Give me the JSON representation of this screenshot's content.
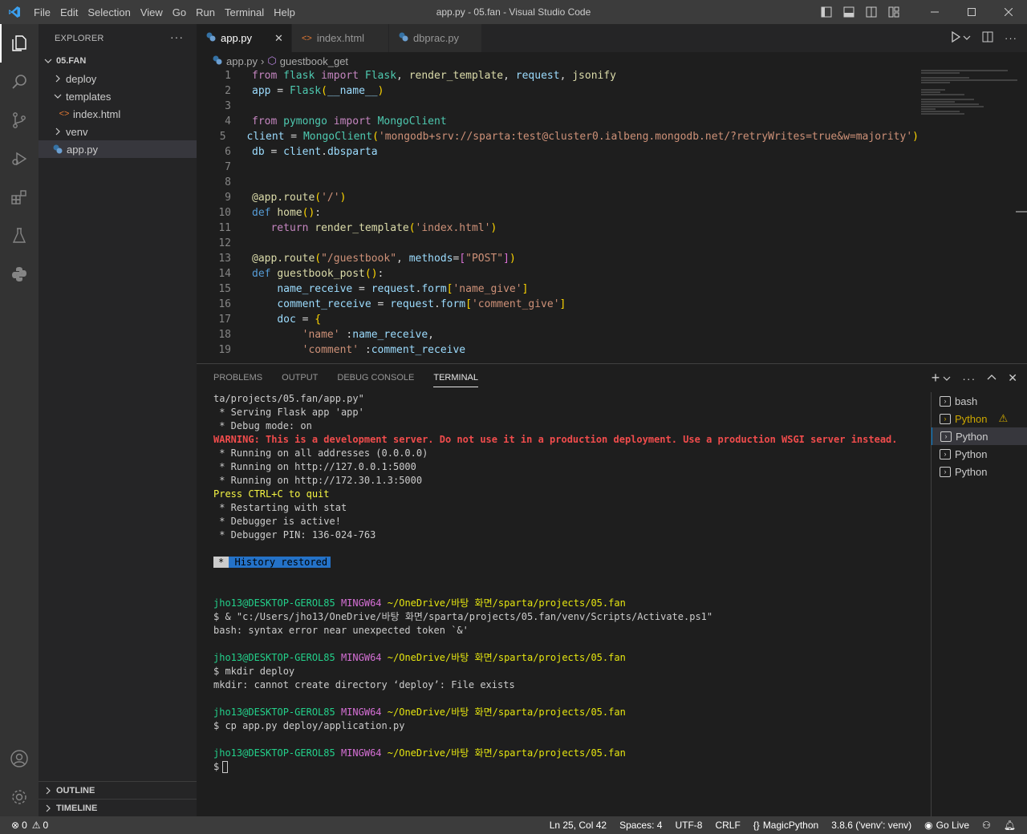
{
  "window": {
    "title": "app.py - 05.fan - Visual Studio Code",
    "menu": [
      "File",
      "Edit",
      "Selection",
      "View",
      "Go",
      "Run",
      "Terminal",
      "Help"
    ]
  },
  "sidebar": {
    "header": "EXPLORER",
    "root": "05.FAN",
    "items": [
      {
        "label": "deploy",
        "type": "folder",
        "expanded": false
      },
      {
        "label": "templates",
        "type": "folder",
        "expanded": true
      },
      {
        "label": "index.html",
        "type": "html-file"
      },
      {
        "label": "venv",
        "type": "folder",
        "expanded": false
      },
      {
        "label": "app.py",
        "type": "python-file",
        "selected": true
      }
    ],
    "outline": "OUTLINE",
    "timeline": "TIMELINE"
  },
  "tabs": [
    {
      "label": "app.py",
      "active": true
    },
    {
      "label": "index.html",
      "active": false
    },
    {
      "label": "dbprac.py",
      "active": false
    }
  ],
  "breadcrumb": {
    "file": "app.py",
    "symbol": "guestbook_get"
  },
  "code_lines": [
    "1",
    "2",
    "3",
    "4",
    "5",
    "6",
    "7",
    "8",
    "9",
    "10",
    "11",
    "12",
    "13",
    "14",
    "15",
    "16",
    "17",
    "18",
    "19"
  ],
  "panel": {
    "tabs": [
      "PROBLEMS",
      "OUTPUT",
      "DEBUG CONSOLE",
      "TERMINAL"
    ],
    "active_tab": "TERMINAL",
    "terminals": [
      {
        "label": "bash"
      },
      {
        "label": "Python",
        "warning": true
      },
      {
        "label": "Python",
        "selected": true
      },
      {
        "label": "Python"
      },
      {
        "label": "Python"
      }
    ],
    "output": {
      "l1": "ta/projects/05.fan/app.py\"",
      "l2": " * Serving Flask app 'app'",
      "l3": " * Debug mode: on",
      "l4": "WARNING: This is a development server. Do not use it in a production deployment. Use a production WSGI server instead.",
      "l5": " * Running on all addresses (0.0.0.0)",
      "l6": " * Running on http://127.0.0.1:5000",
      "l7": " * Running on http://172.30.1.3:5000",
      "l8": "Press CTRL+C to quit",
      "l9": " * Restarting with stat",
      "l10": " * Debugger is active!",
      "l11": " * Debugger PIN: 136-024-763",
      "hist_star": "*",
      "hist_text": "History restored",
      "user": "jho13@DESKTOP-GEROL85",
      "shell": "MINGW64",
      "path": "~/OneDrive/바탕 화면/sparta/projects/05.fan",
      "c1": "$ & \"c:/Users/jho13/OneDrive/바탕 화면/sparta/projects/05.fan/venv/Scripts/Activate.ps1\"",
      "r1": "bash: syntax error near unexpected token `&'",
      "c2": "$ mkdir deploy",
      "r2": "mkdir: cannot create directory ‘deploy’: File exists",
      "c3": "$ cp app.py deploy/application.py",
      "prompt": "$"
    }
  },
  "status": {
    "errors": "0",
    "warnings": "0",
    "position": "Ln 25, Col 42",
    "spaces": "Spaces: 4",
    "encoding": "UTF-8",
    "eol": "CRLF",
    "language": "MagicPython",
    "interpreter": "3.8.6 ('venv': venv)",
    "golive": "Go Live"
  },
  "colors": {
    "accent": "#007fd4",
    "warning": "#f14c4c",
    "prompt_user": "#23d18b",
    "prompt_shell": "#d670d6",
    "prompt_path": "#e5e510"
  }
}
